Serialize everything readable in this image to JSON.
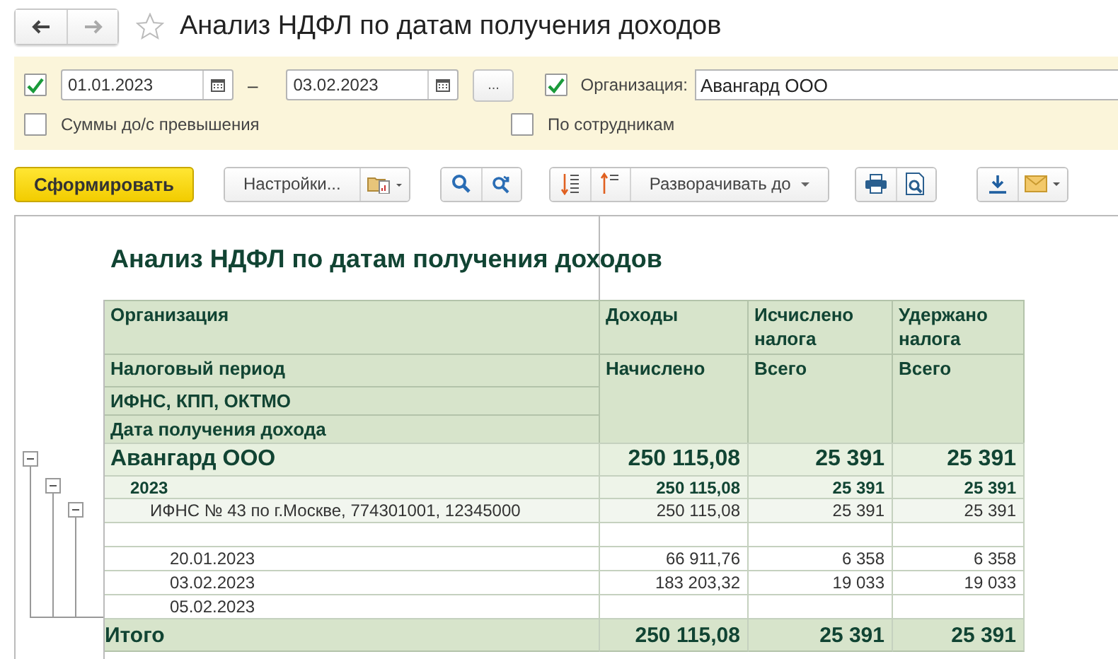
{
  "window": {
    "title": "Анализ НДФЛ по датам получения доходов",
    "favorite": false
  },
  "filters": {
    "period_checked": true,
    "date_from": "01.01.2023",
    "dash": "–",
    "date_to": "03.02.2023",
    "more": "...",
    "organization": {
      "checked": true,
      "label": "Организация:",
      "value": "Авангард ООО"
    },
    "options": [
      {
        "label": "Суммы до/с превышения",
        "checked": false
      },
      {
        "label": "По сотрудникам",
        "checked": false
      }
    ]
  },
  "toolbar": {
    "generate": "Сформировать",
    "settings": "Настройки...",
    "expand_to": "Разворачивать до"
  },
  "report": {
    "title": "Анализ НДФЛ по датам получения доходов",
    "columns": [
      "Организация",
      "Доходы",
      "Исчислено налога",
      "Удержано налога"
    ],
    "groupings": [
      "Налоговый период",
      "ИФНС, КПП, ОКТМО",
      "Дата получения дохода"
    ],
    "subheaders": [
      "Начислено",
      "Всего",
      "Всего"
    ],
    "rows": [
      {
        "kind": "group",
        "label": "Авангард ООО",
        "values": [
          "250 115,08",
          "25 391",
          "25 391"
        ],
        "expanded": true,
        "children": [
          {
            "kind": "group",
            "label": "2023",
            "values": [
              "250 115,08",
              "25 391",
              "25 391"
            ],
            "expanded": true,
            "children": [
              {
                "kind": "group",
                "label": "ИФНС № 43 по г.Москве, 774301001, 12345000",
                "values": [
                  "250 115,08",
                  "25 391",
                  "25 391"
                ],
                "expanded": true,
                "children": [
                  {
                    "kind": "blank"
                  },
                  {
                    "kind": "date",
                    "label": "20.01.2023",
                    "values": [
                      "66 911,76",
                      "6 358",
                      "6 358"
                    ]
                  },
                  {
                    "kind": "date",
                    "label": "03.02.2023",
                    "values": [
                      "183 203,32",
                      "19 033",
                      "19 033"
                    ]
                  },
                  {
                    "kind": "date",
                    "label": "05.02.2023"
                  }
                ]
              }
            ]
          }
        ]
      }
    ],
    "total": {
      "label": "Итого",
      "values": [
        "250 115,08",
        "25 391",
        "25 391"
      ]
    }
  }
}
